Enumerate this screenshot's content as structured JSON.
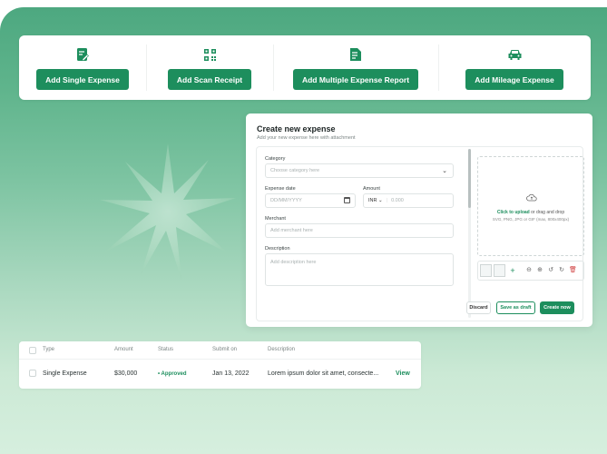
{
  "actions": [
    {
      "label": "Add Single Expense",
      "icon": "edit-document-icon"
    },
    {
      "label": "Add Scan Receipt",
      "icon": "qr-scan-icon"
    },
    {
      "label": "Add Multiple Expense Report",
      "icon": "report-icon"
    },
    {
      "label": "Add Mileage Expense",
      "icon": "car-icon"
    }
  ],
  "panel": {
    "title": "Create new expense",
    "subtitle": "Add your new expense here with attachment",
    "category_label": "Category",
    "category_placeholder": "Choose category here",
    "date_label": "Expense date",
    "date_placeholder": "DD/MM/YYYY",
    "amount_label": "Amount",
    "currency": "INR",
    "amount_placeholder": "0.000",
    "merchant_label": "Merchant",
    "merchant_placeholder": "Add merchant here",
    "description_label": "Description",
    "description_placeholder": "Add description here",
    "upload_link": "Click to upload",
    "upload_text": " or drag and drop",
    "upload_hint": "SVG, PNG, JPG or GIF (max, 800x400px)",
    "discard": "Discard",
    "save_draft": "Save as draft",
    "create": "Create now"
  },
  "table": {
    "headers": [
      "Type",
      "Amount",
      "Status",
      "Submit on",
      "Description"
    ],
    "row": {
      "type": "Single Expense",
      "amount": "$30,000",
      "status": "Approved",
      "submit_on": "Jan 13, 2022",
      "description": "Lorem ipsum dolor sit amet, consecte...",
      "action": "View"
    }
  },
  "colors": {
    "accent": "#1d8e5d",
    "background": "#5fb48c"
  }
}
